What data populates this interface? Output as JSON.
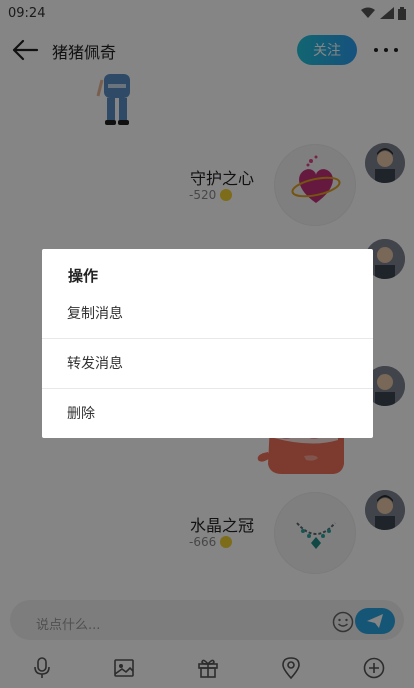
{
  "status_bar": {
    "time": "09:24"
  },
  "header": {
    "title": "猪猪佩奇",
    "follow_label": "关注"
  },
  "messages": [
    {
      "gift_name": "守护之心",
      "price": "-520"
    },
    {
      "gift_name": "水晶之冠",
      "price": "-666"
    }
  ],
  "input": {
    "placeholder": "说点什么..."
  },
  "dialog": {
    "title": "操作",
    "items": [
      {
        "label": "复制消息"
      },
      {
        "label": "转发消息"
      },
      {
        "label": "删除"
      }
    ]
  },
  "colors": {
    "accent": "#2aa6e4",
    "follow_gradient_start": "#22c3d9",
    "follow_gradient_end": "#2b9cf0",
    "overlay": "rgba(0,0,0,0.48)",
    "coin": "#f0d030"
  },
  "icons": {
    "back": "arrow-left-icon",
    "more": "more-dots-icon",
    "emoji": "smiley-icon",
    "send": "paper-plane-icon",
    "toolbar": [
      "microphone-icon",
      "image-icon",
      "gift-icon",
      "location-icon",
      "plus-circle-icon"
    ]
  }
}
